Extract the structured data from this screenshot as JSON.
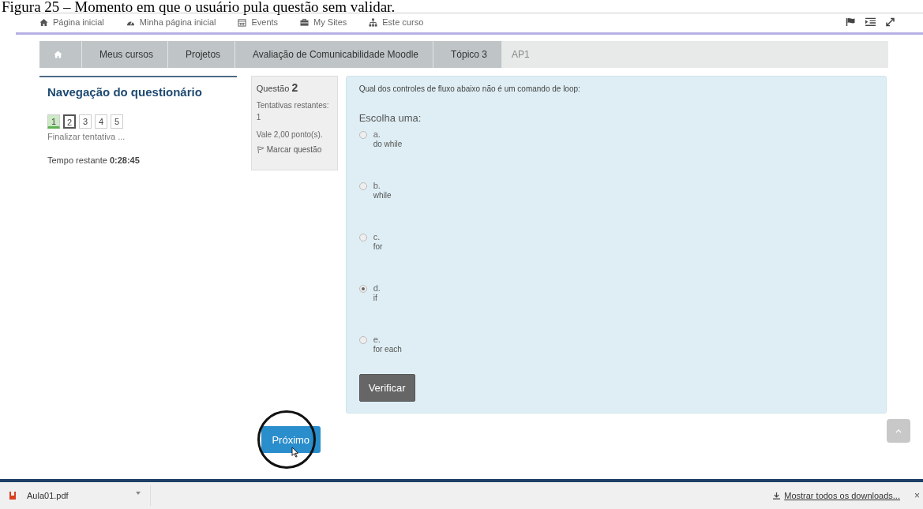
{
  "caption": "Figura 25 – Momento em que o usuário pula questão sem validar.",
  "top_nav": [
    {
      "label": "Página inicial"
    },
    {
      "label": "Minha página inicial"
    },
    {
      "label": "Events"
    },
    {
      "label": "My Sites"
    },
    {
      "label": "Este curso"
    }
  ],
  "breadcrumb": [
    {
      "label": "Meus cursos",
      "current": false
    },
    {
      "label": "Projetos",
      "current": false
    },
    {
      "label": "Avaliação de Comunicabilidade Moodle",
      "current": false
    },
    {
      "label": "Tópico 3",
      "current": false
    },
    {
      "label": "AP1",
      "current": true
    }
  ],
  "quiz_nav": {
    "title": "Navegação do questionário",
    "questions": [
      {
        "label": "1",
        "answered": true,
        "selected": false
      },
      {
        "label": "2",
        "answered": false,
        "selected": true
      },
      {
        "label": "3",
        "answered": false,
        "selected": false
      },
      {
        "label": "4",
        "answered": false,
        "selected": false
      },
      {
        "label": "5",
        "answered": false,
        "selected": false
      }
    ],
    "finish_link": "Finalizar tentativa ...",
    "time_label": "Tempo restante",
    "time_value": "0:28:45"
  },
  "question_info": {
    "label": "Questão",
    "number": "2",
    "attempts": "Tentativas restantes: 1",
    "points": "Vale 2,00 ponto(s).",
    "flag": "Marcar questão"
  },
  "question": {
    "text": "Qual dos controles de fluxo abaixo não é um comando de loop:",
    "prompt": "Escolha uma:",
    "options": [
      {
        "letter": "a.",
        "text": "do while",
        "selected": false
      },
      {
        "letter": "b.",
        "text": "while",
        "selected": false
      },
      {
        "letter": "c.",
        "text": "for",
        "selected": false
      },
      {
        "letter": "d.",
        "text": "if",
        "selected": true
      },
      {
        "letter": "e.",
        "text": "for each",
        "selected": false
      }
    ],
    "check_button": "Verificar"
  },
  "next_button": "Próximo",
  "download_bar": {
    "file": "Aula01.pdf",
    "show_all": "Mostrar todos os downloads...",
    "close": "×"
  }
}
